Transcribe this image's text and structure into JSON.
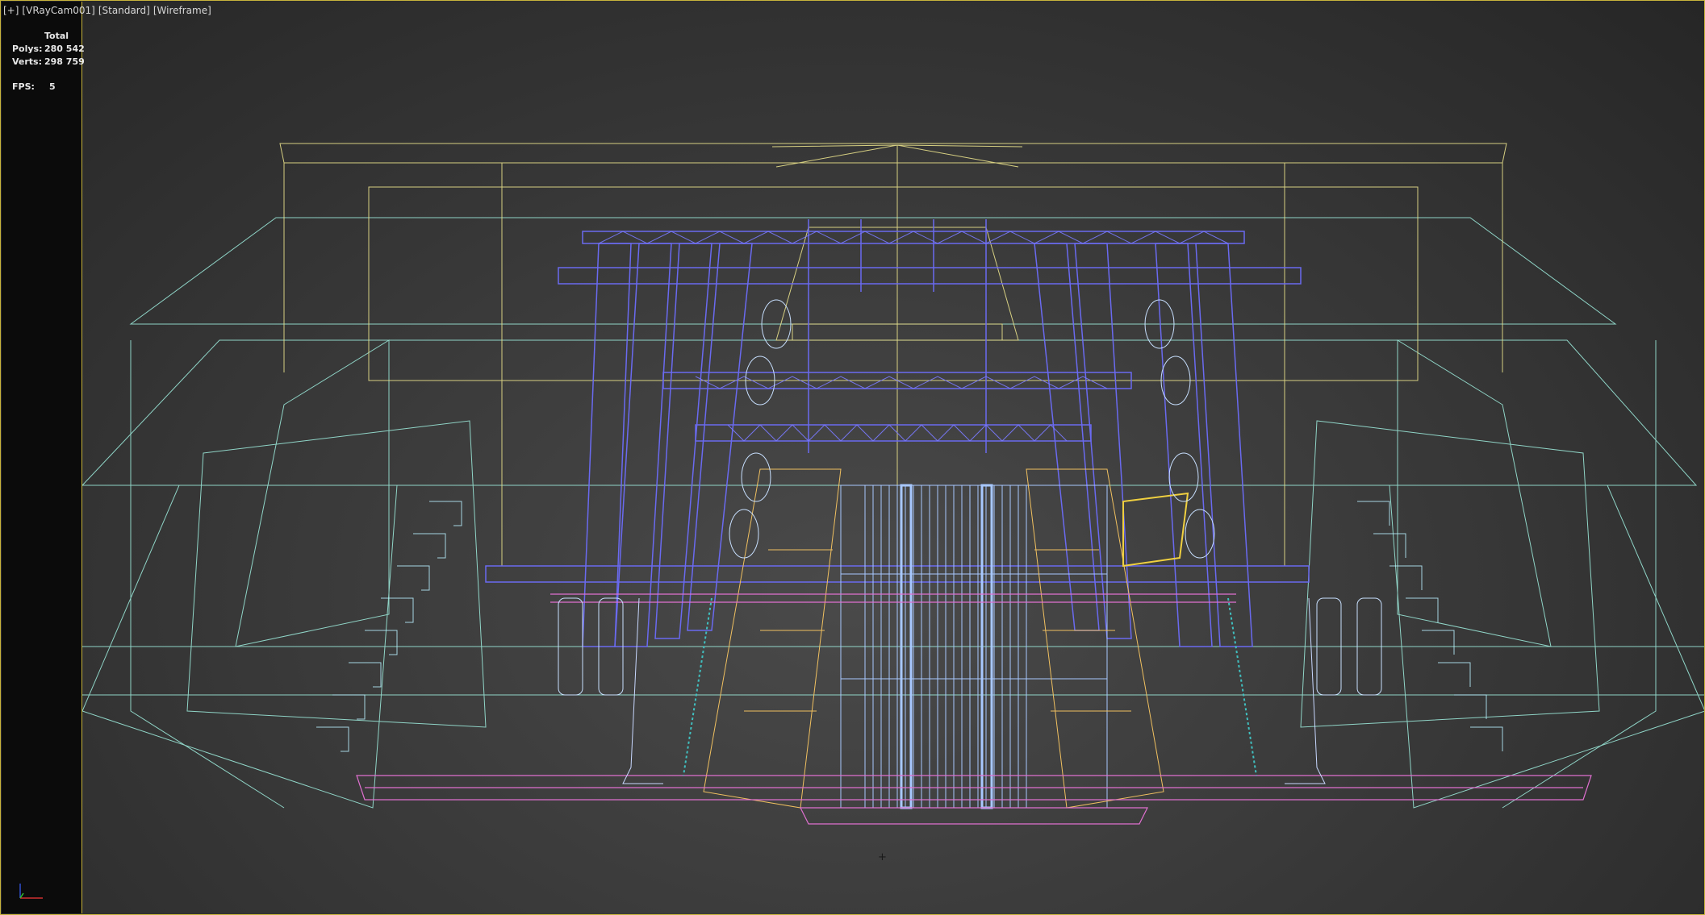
{
  "viewport": {
    "labels": {
      "plus": "[+]",
      "camera": "[VRayCam001]",
      "shading_mode": "[Standard]",
      "display_mode": "[Wireframe]"
    },
    "stats": {
      "header": "Total",
      "polys_label": "Polys:",
      "polys_value": "280 542",
      "verts_label": "Verts:",
      "verts_value": "298 759",
      "fps_label": "FPS:",
      "fps_value": "5"
    },
    "axis_gizmo": {
      "name": "world-axis-tripod-icon"
    },
    "cursor_mark": "+"
  },
  "colors": {
    "frame_border": "#c8b43c",
    "wire_yellow": "#e8e08a",
    "wire_cyan": "#9ff0e0",
    "wire_blue": "#6a6af0",
    "wire_lightblue": "#a8c8ff",
    "wire_pink": "#e070d0",
    "wire_orange": "#f0c060",
    "wire_teal": "#40c0c0"
  }
}
